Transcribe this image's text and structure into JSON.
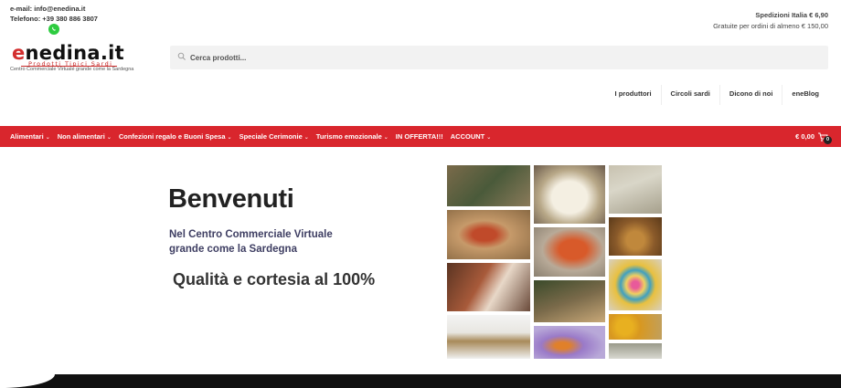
{
  "topbar": {
    "email": "e-mail: info@enedina.it",
    "phone": "Telefono: +39 380 886 3807",
    "shipping_line1": "Spedizioni Italia € 6,90",
    "shipping_line2": "Gratuite per ordini di almeno € 150,00",
    "whatsapp_icon": "whatsapp-icon"
  },
  "brand": {
    "logo_first": "e",
    "logo_rest": "nedina.it",
    "logo_sub": "Prodotti Tipici Sardi",
    "tagline": "Centro Commerciale Virtuale grande come la Sardegna",
    "accent": "#d9262d"
  },
  "search": {
    "placeholder": "Cerca prodotti..."
  },
  "secondary_nav": [
    "I produttori",
    "Circoli sardi",
    "Dicono di noi",
    "eneBlog"
  ],
  "main_nav": {
    "items": [
      {
        "label": "Alimentari",
        "dropdown": true
      },
      {
        "label": "Non alimentari",
        "dropdown": true
      },
      {
        "label": "Confezioni regalo e Buoni Spesa",
        "dropdown": true
      },
      {
        "label": "Speciale Cerimonie",
        "dropdown": true
      },
      {
        "label": "Turismo emozionale",
        "dropdown": true
      },
      {
        "label": "IN OFFERTA!!!",
        "dropdown": false
      },
      {
        "label": "ACCOUNT",
        "dropdown": true
      }
    ],
    "cart_total": "€ 0,00",
    "cart_count": "0"
  },
  "hero": {
    "title": "Benvenuti",
    "sub1": "Nel Centro Commerciale Virtuale",
    "sub2": "grande come la Sardegna",
    "quality": "Qualità e cortesia al 100%"
  }
}
